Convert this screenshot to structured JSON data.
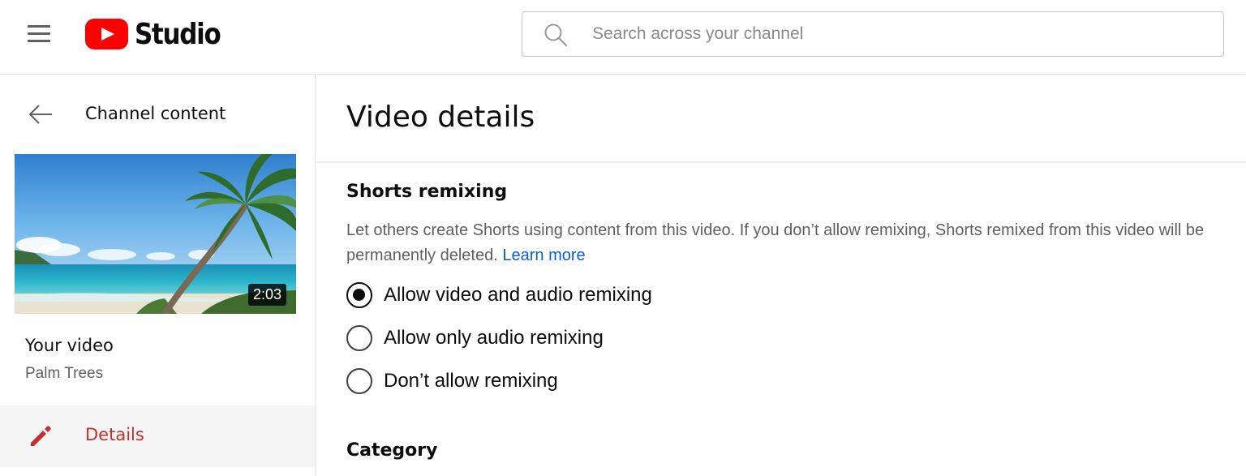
{
  "header": {
    "logo_text": "Studio",
    "search": {
      "placeholder": "Search across your channel",
      "value": ""
    }
  },
  "sidebar": {
    "back_label": "Channel content",
    "video": {
      "duration": "2:03",
      "heading": "Your video",
      "title": "Palm Trees"
    },
    "nav": [
      {
        "label": "Details",
        "active": true,
        "icon": "pencil-icon"
      }
    ]
  },
  "main": {
    "page_title": "Video details",
    "shorts_remixing": {
      "heading": "Shorts remixing",
      "description": "Let others create Shorts using content from this video. If you don’t allow remixing, Shorts remixed from this video will be permanently deleted.",
      "learn_more": "Learn more",
      "options": [
        {
          "label": "Allow video and audio remixing",
          "checked": true
        },
        {
          "label": "Allow only audio remixing",
          "checked": false
        },
        {
          "label": "Don’t allow remixing",
          "checked": false
        }
      ]
    },
    "category": {
      "heading": "Category"
    }
  },
  "colors": {
    "brand_red": "#ff0000",
    "active_nav": "#c4302b",
    "link": "#065fd4",
    "secondary_text": "#606060"
  }
}
